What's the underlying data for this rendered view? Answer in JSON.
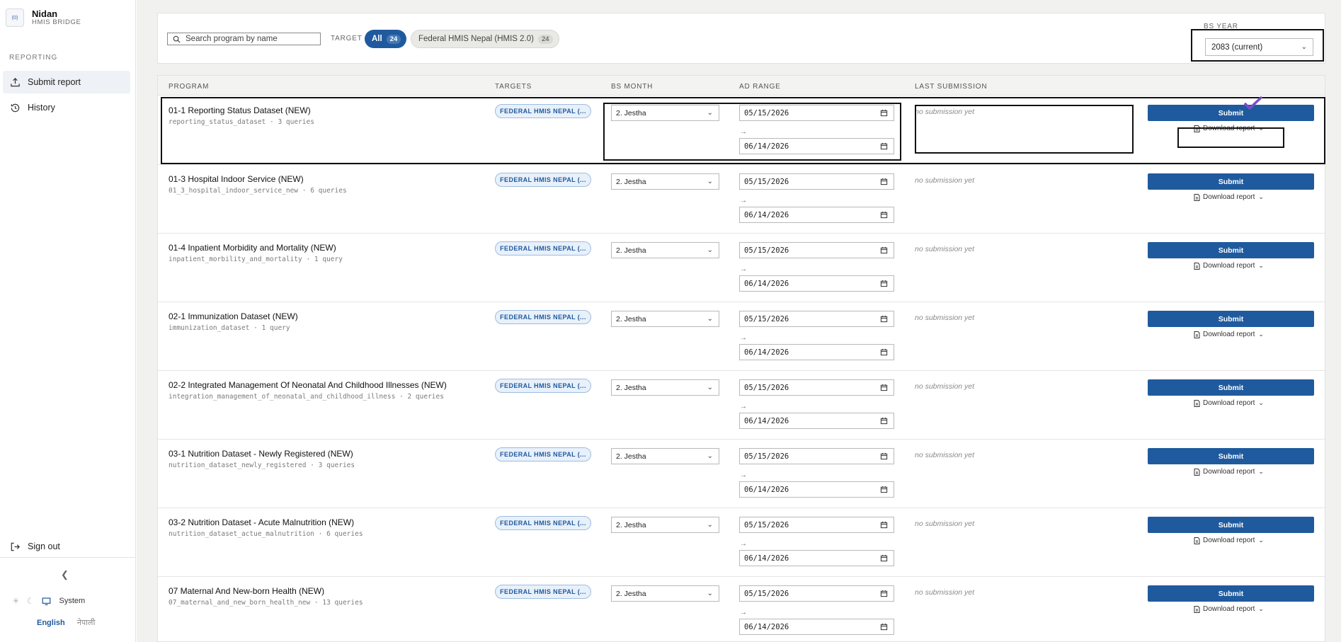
{
  "app": {
    "name": "Nidan",
    "subtitle": "HMIS BRIDGE",
    "logo_text": "(0)"
  },
  "sidebar": {
    "section": "REPORTING",
    "items": [
      {
        "label": "Submit report",
        "icon": "upload-icon",
        "active": true
      },
      {
        "label": "History",
        "icon": "history-icon",
        "active": false
      }
    ],
    "signout": "Sign out",
    "theme": {
      "label": "System",
      "icons": [
        "sun-icon",
        "moon-icon",
        "monitor-icon"
      ]
    },
    "languages": {
      "english": "English",
      "nepali": "नेपाली"
    }
  },
  "filters": {
    "search_placeholder": "Search program by name",
    "target_label": "TARGET",
    "chips": [
      {
        "label": "All",
        "count": "24",
        "selected": true
      },
      {
        "label": "Federal HMIS Nepal (HMIS 2.0)",
        "count": "24",
        "selected": false
      }
    ],
    "bs_year_label": "BS YEAR",
    "bs_year_value": "2083 (current)"
  },
  "table": {
    "headers": {
      "program": "PROGRAM",
      "targets": "TARGETS",
      "bs_month": "BS MONTH",
      "ad_range": "AD RANGE",
      "last_submission": "LAST SUBMISSION"
    },
    "rows": [
      {
        "title": "01-1 Reporting Status Dataset (NEW)",
        "code": "reporting_status_dataset",
        "queries": "3 queries",
        "target": "FEDERAL HMIS NEPAL (...",
        "month": "2. Jestha",
        "ad_from": "05/15/2026",
        "ad_to": "06/14/2026",
        "last_submission": "no submission yet",
        "submit": "Submit",
        "download": "Download report"
      },
      {
        "title": "01-3 Hospital Indoor Service (NEW)",
        "code": "01_3_hospital_indoor_service_new",
        "queries": "6 queries",
        "target": "FEDERAL HMIS NEPAL (...",
        "month": "2. Jestha",
        "ad_from": "05/15/2026",
        "ad_to": "06/14/2026",
        "last_submission": "no submission yet",
        "submit": "Submit",
        "download": "Download report"
      },
      {
        "title": "01-4 Inpatient Morbidity and Mortality (NEW)",
        "code": "inpatient_morbility_and_mortality",
        "queries": "1 query",
        "target": "FEDERAL HMIS NEPAL (...",
        "month": "2. Jestha",
        "ad_from": "05/15/2026",
        "ad_to": "06/14/2026",
        "last_submission": "no submission yet",
        "submit": "Submit",
        "download": "Download report"
      },
      {
        "title": "02-1 Immunization Dataset (NEW)",
        "code": "immunization_dataset",
        "queries": "1 query",
        "target": "FEDERAL HMIS NEPAL (...",
        "month": "2. Jestha",
        "ad_from": "05/15/2026",
        "ad_to": "06/14/2026",
        "last_submission": "no submission yet",
        "submit": "Submit",
        "download": "Download report"
      },
      {
        "title": "02-2 Integrated Management Of Neonatal And Childhood Illnesses (NEW)",
        "code": "integration_management_of_neonatal_and_childhood_illness",
        "queries": "2 queries",
        "target": "FEDERAL HMIS NEPAL (...",
        "month": "2. Jestha",
        "ad_from": "05/15/2026",
        "ad_to": "06/14/2026",
        "last_submission": "no submission yet",
        "submit": "Submit",
        "download": "Download report"
      },
      {
        "title": "03-1 Nutrition Dataset - Newly Registered (NEW)",
        "code": "nutrition_dataset_newly_registered",
        "queries": "3 queries",
        "target": "FEDERAL HMIS NEPAL (...",
        "month": "2. Jestha",
        "ad_from": "05/15/2026",
        "ad_to": "06/14/2026",
        "last_submission": "no submission yet",
        "submit": "Submit",
        "download": "Download report"
      },
      {
        "title": "03-2 Nutrition Dataset - Acute Malnutrition (NEW)",
        "code": "nutrition_dataset_actue_malnutrition",
        "queries": "6 queries",
        "target": "FEDERAL HMIS NEPAL (...",
        "month": "2. Jestha",
        "ad_from": "05/15/2026",
        "ad_to": "06/14/2026",
        "last_submission": "no submission yet",
        "submit": "Submit",
        "download": "Download report"
      },
      {
        "title": "07 Maternal And New-born Health (NEW)",
        "code": "07_maternal_and_new_born_health_new",
        "queries": "13 queries",
        "target": "FEDERAL HMIS NEPAL (...",
        "month": "2. Jestha",
        "ad_from": "05/15/2026",
        "ad_to": "06/14/2026",
        "last_submission": "no submission yet",
        "submit": "Submit",
        "download": "Download report"
      }
    ]
  },
  "colors": {
    "primary": "#1f5a9e",
    "sidebar_active": "#eef1f5",
    "background": "#f1f1ef",
    "cursor": "#7b4fc4"
  }
}
